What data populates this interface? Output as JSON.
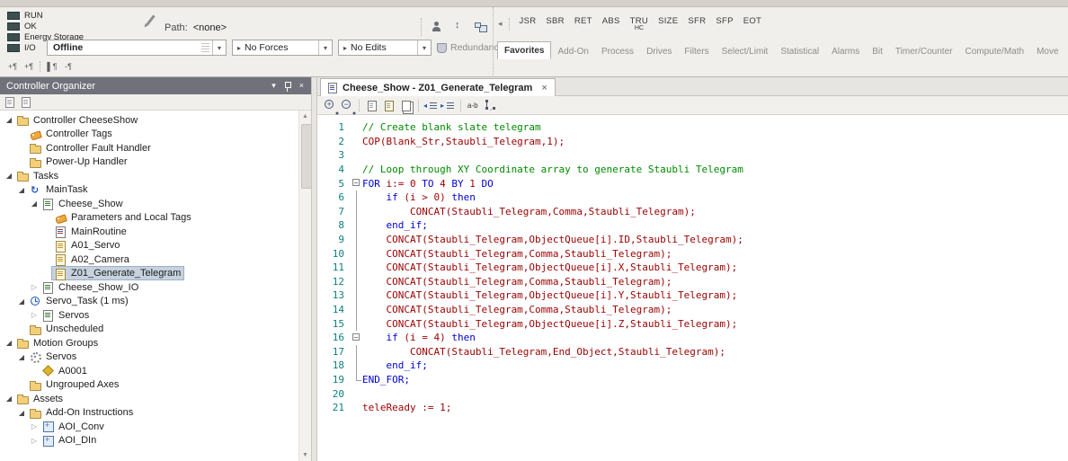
{
  "colors": {
    "comment": "#008a00",
    "keyword": "#0000d6",
    "tag": "#9b0000",
    "linenum": "#0d8080",
    "selection": "#c7d2df",
    "accent_blue": "#2459b8"
  },
  "icons": {
    "expanded": "◢",
    "collapsed": "▷",
    "chevron_down": "▾",
    "close": "×",
    "scroll_up": "▲",
    "scroll_down": "▼",
    "lead_arrow": "▸",
    "chevron_left": "◂"
  },
  "top": {
    "status_items": [
      "RUN",
      "OK",
      "Energy Storage",
      "I/O"
    ],
    "path": {
      "label": "Path:",
      "value": "<none>"
    },
    "combos": {
      "offline": "Offline",
      "no_forces": "No Forces",
      "no_edits": "No Edits",
      "redundancy": "Redundancy"
    },
    "mnemonics": [
      {
        "l": "JSR"
      },
      {
        "l": "SBR"
      },
      {
        "l": "RET"
      },
      {
        "l": "ABS"
      },
      {
        "l": "TRU",
        "s": "HC"
      },
      {
        "l": "SIZE"
      },
      {
        "l": "SFR"
      },
      {
        "l": "SFP"
      },
      {
        "l": "EOT"
      }
    ],
    "palette_tabs": [
      {
        "label": "Favorites",
        "selected": true
      },
      {
        "label": "Add-On"
      },
      {
        "label": "Process"
      },
      {
        "label": "Drives"
      },
      {
        "label": "Filters"
      },
      {
        "label": "Select/Limit"
      },
      {
        "label": "Statistical"
      },
      {
        "label": "Alarms"
      },
      {
        "label": "Bit"
      },
      {
        "label": "Timer/Counter"
      },
      {
        "label": "Compute/Math"
      },
      {
        "label": "Move"
      }
    ],
    "bookmark_icons": [
      "+¶",
      "+¶",
      "▌¶",
      "-¶"
    ]
  },
  "organizer": {
    "title": "Controller Organizer",
    "tree": [
      {
        "label": "Controller CheeseShow",
        "depth": 0,
        "icon": "folder",
        "exp": "open"
      },
      {
        "label": "Controller Tags",
        "depth": 1,
        "icon": "tags"
      },
      {
        "label": "Controller Fault Handler",
        "depth": 1,
        "icon": "folder"
      },
      {
        "label": "Power-Up Handler",
        "depth": 1,
        "icon": "folder"
      },
      {
        "label": "Tasks",
        "depth": 0,
        "icon": "folder",
        "exp": "open"
      },
      {
        "label": "MainTask",
        "depth": 1,
        "icon": "task",
        "exp": "open"
      },
      {
        "label": "Cheese_Show",
        "depth": 2,
        "icon": "program",
        "exp": "open"
      },
      {
        "label": "Parameters and Local Tags",
        "depth": 3,
        "icon": "tags"
      },
      {
        "label": "MainRoutine",
        "depth": 3,
        "icon": "routine-main"
      },
      {
        "label": "A01_Servo",
        "depth": 3,
        "icon": "routine-st"
      },
      {
        "label": "A02_Camera",
        "depth": 3,
        "icon": "routine-st"
      },
      {
        "label": "Z01_Generate_Telegram",
        "depth": 3,
        "icon": "routine-st",
        "selected": true
      },
      {
        "label": "Cheese_Show_IO",
        "depth": 2,
        "icon": "program",
        "exp": "closed"
      },
      {
        "label": "Servo_Task (1 ms)",
        "depth": 1,
        "icon": "clock-task",
        "exp": "open"
      },
      {
        "label": "Servos",
        "depth": 2,
        "icon": "program",
        "exp": "closed"
      },
      {
        "label": "Unscheduled",
        "depth": 1,
        "icon": "folder"
      },
      {
        "label": "Motion Groups",
        "depth": 0,
        "icon": "folder",
        "exp": "open"
      },
      {
        "label": "Servos",
        "depth": 1,
        "icon": "motion-group",
        "exp": "open"
      },
      {
        "label": "A0001",
        "depth": 2,
        "icon": "axis"
      },
      {
        "label": "Ungrouped Axes",
        "depth": 1,
        "icon": "folder"
      },
      {
        "label": "Assets",
        "depth": 0,
        "icon": "folder",
        "exp": "open"
      },
      {
        "label": "Add-On Instructions",
        "depth": 1,
        "icon": "folder",
        "exp": "open"
      },
      {
        "label": "AOI_Conv",
        "depth": 2,
        "icon": "aoi",
        "exp": "closed"
      },
      {
        "label": "AOI_DIn",
        "depth": 2,
        "icon": "aoi",
        "exp": "closed"
      }
    ]
  },
  "editor": {
    "tab_title": "Cheese_Show - Z01_Generate_Telegram",
    "toolbar_icons": [
      "zoom-in",
      "zoom-out",
      "sep",
      "copy",
      "paste",
      "duplicate",
      "sep",
      "outdent",
      "indent",
      "sep",
      "ab",
      "branch"
    ],
    "lines": [
      {
        "n": 1,
        "f": "",
        "s": [
          [
            "c",
            "// Create blank slate telegram"
          ]
        ]
      },
      {
        "n": 2,
        "f": "",
        "s": [
          [
            "t",
            "COP(Blank_Str,Staubli_Telegram,1);"
          ]
        ]
      },
      {
        "n": 3,
        "f": "",
        "s": []
      },
      {
        "n": 4,
        "f": "",
        "s": [
          [
            "c",
            "// Loop through XY Coordinate array to generate Staubli Telegram"
          ]
        ]
      },
      {
        "n": 5,
        "f": "box",
        "s": [
          [
            "k",
            "FOR"
          ],
          [
            "t",
            " i:= 0 "
          ],
          [
            "k",
            "TO"
          ],
          [
            "t",
            " 4 "
          ],
          [
            "k",
            "BY"
          ],
          [
            "t",
            " 1 "
          ],
          [
            "k",
            "DO"
          ]
        ]
      },
      {
        "n": 6,
        "f": "v",
        "s": [
          [
            "t",
            "    "
          ],
          [
            "k",
            "if"
          ],
          [
            "t",
            " (i > 0) "
          ],
          [
            "k",
            "then"
          ]
        ]
      },
      {
        "n": 7,
        "f": "v",
        "s": [
          [
            "t",
            "        CONCAT(Staubli_Telegram,Comma,Staubli_Telegram);"
          ]
        ]
      },
      {
        "n": 8,
        "f": "v",
        "s": [
          [
            "t",
            "    "
          ],
          [
            "k",
            "end_if;"
          ]
        ]
      },
      {
        "n": 9,
        "f": "v",
        "s": [
          [
            "t",
            "    CONCAT(Staubli_Telegram,ObjectQueue[i].ID,Staubli_Telegram);"
          ]
        ]
      },
      {
        "n": 10,
        "f": "v",
        "s": [
          [
            "t",
            "    CONCAT(Staubli_Telegram,Comma,Staubli_Telegram);"
          ]
        ]
      },
      {
        "n": 11,
        "f": "v",
        "s": [
          [
            "t",
            "    CONCAT(Staubli_Telegram,ObjectQueue[i].X,Staubli_Telegram);"
          ]
        ]
      },
      {
        "n": 12,
        "f": "v",
        "s": [
          [
            "t",
            "    CONCAT(Staubli_Telegram,Comma,Staubli_Telegram);"
          ]
        ]
      },
      {
        "n": 13,
        "f": "v",
        "s": [
          [
            "t",
            "    CONCAT(Staubli_Telegram,ObjectQueue[i].Y,Staubli_Telegram);"
          ]
        ]
      },
      {
        "n": 14,
        "f": "v",
        "s": [
          [
            "t",
            "    CONCAT(Staubli_Telegram,Comma,Staubli_Telegram);"
          ]
        ]
      },
      {
        "n": 15,
        "f": "v",
        "s": [
          [
            "t",
            "    CONCAT(Staubli_Telegram,ObjectQueue[i].Z,Staubli_Telegram);"
          ]
        ]
      },
      {
        "n": 16,
        "f": "box",
        "s": [
          [
            "t",
            "    "
          ],
          [
            "k",
            "if"
          ],
          [
            "t",
            " (i = 4) "
          ],
          [
            "k",
            "then"
          ]
        ]
      },
      {
        "n": 17,
        "f": "v",
        "s": [
          [
            "t",
            "        CONCAT(Staubli_Telegram,End_Object,Staubli_Telegram);"
          ]
        ]
      },
      {
        "n": 18,
        "f": "v",
        "s": [
          [
            "t",
            "    "
          ],
          [
            "k",
            "end_if;"
          ]
        ]
      },
      {
        "n": 19,
        "f": "end",
        "s": [
          [
            "k",
            "END_FOR;"
          ]
        ]
      },
      {
        "n": 20,
        "f": "",
        "s": []
      },
      {
        "n": 21,
        "f": "",
        "s": [
          [
            "t",
            "teleReady := 1;"
          ]
        ]
      }
    ]
  }
}
